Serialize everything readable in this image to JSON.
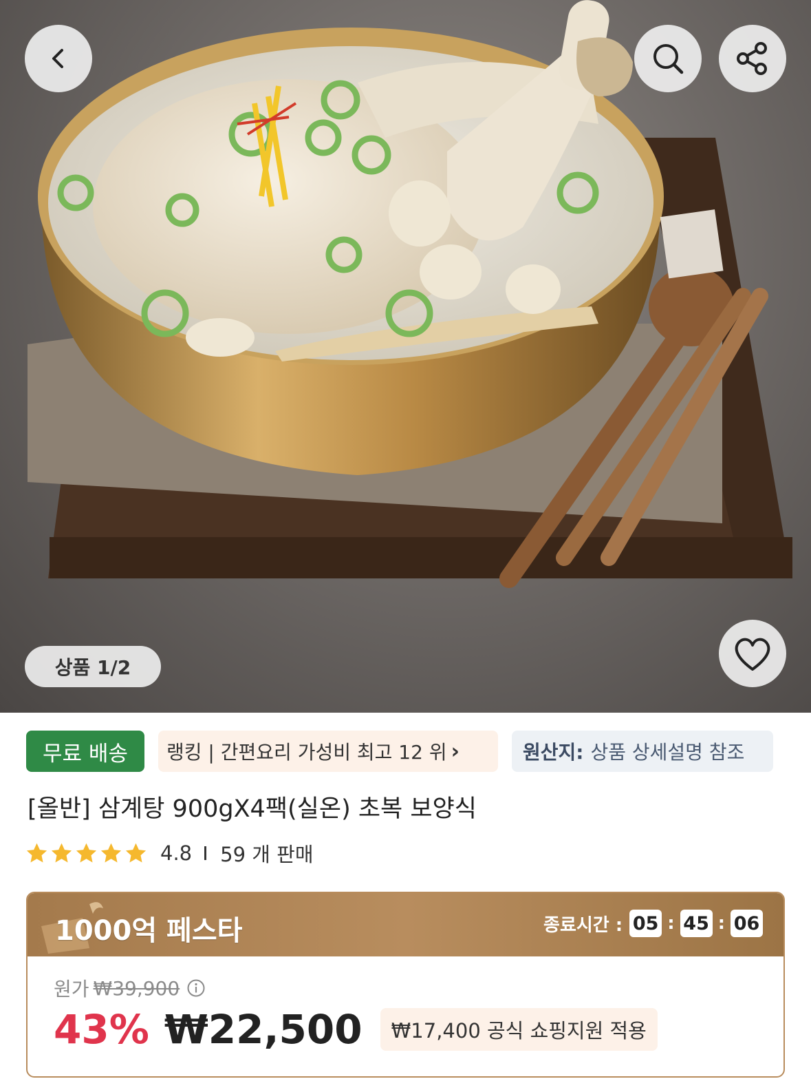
{
  "hero": {
    "counter_label": "상품 1/2",
    "icons": {
      "back": "chevron-left-icon",
      "search": "search-icon",
      "share": "share-icon",
      "like": "heart-icon"
    }
  },
  "badges": {
    "free_shipping": "무료 배송",
    "ranking": "랭킹 | 간편요리 가성비 최고 12 위",
    "origin_label": "원산지:",
    "origin_value": "상품 상세설명 참조"
  },
  "product": {
    "title": "[올반] 삼계탕 900gX4팩(실온) 초복 보양식",
    "rating": "4.8",
    "stars": 5,
    "sold": "59 개 판매"
  },
  "promo": {
    "title": "1000억 페스타",
    "timer_label": "종료시간 :",
    "hours": "05",
    "minutes": "45",
    "seconds": "06",
    "original_label": "원가",
    "original_price": "₩39,900",
    "discount": "43%",
    "sale_price": "₩22,500",
    "support_text": "₩17,400 공식 쇼핑지원 적용"
  },
  "colors": {
    "free_shipping_bg": "#2f8a46",
    "discount_red": "#e0344c",
    "promo_brown": "#b88c5c",
    "star_gold": "#f5b82e"
  }
}
